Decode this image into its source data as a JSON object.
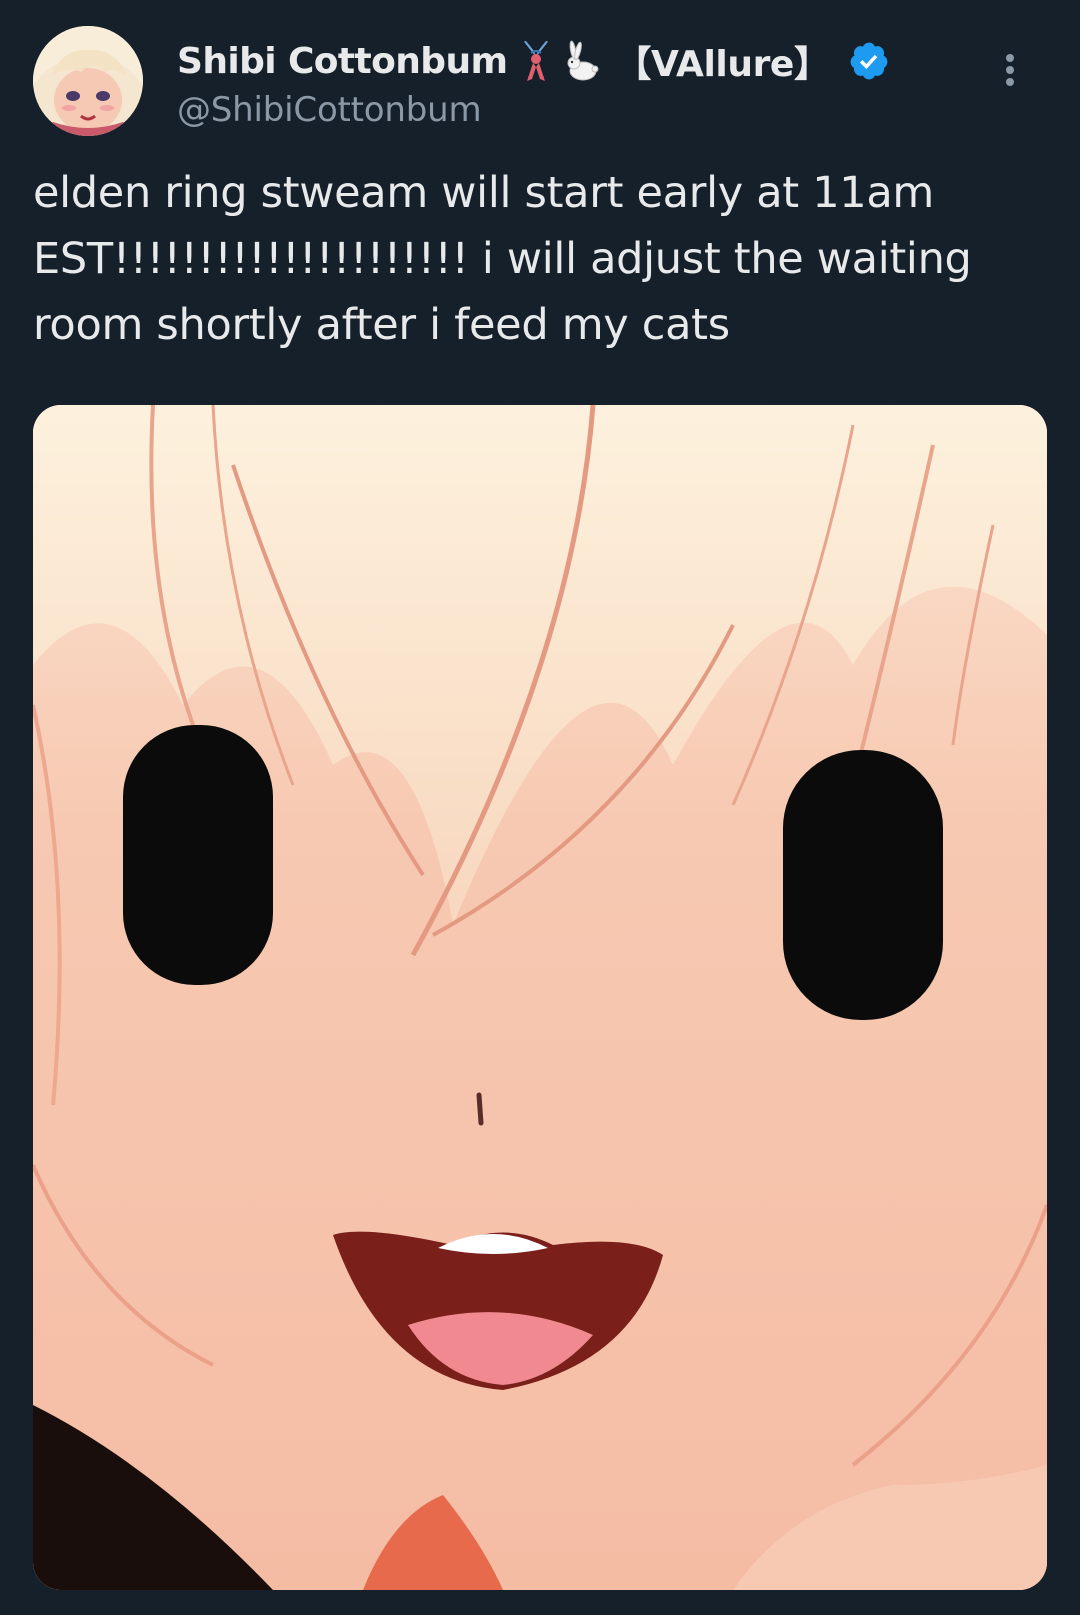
{
  "tweet": {
    "author": {
      "display_name": "Shibi Cottonbum",
      "tag": "【VAllure】",
      "handle": "@ShibiCottonbum",
      "verified": true,
      "name_emojis": [
        "ribbon-emoji",
        "rabbit-emoji"
      ],
      "avatar_icon": "anime-avatar-icon"
    },
    "text": "elden ring stweam will start early at 11am\nEST!!!!!!!!!!!!!!!!!!!!! i will adjust the waiting\nroom shortly after i feed my cats",
    "media": {
      "kind": "image",
      "subject": "anime-face-closeup"
    },
    "more_icon": "more-vertical-icon"
  },
  "colors": {
    "background": "#15202b",
    "text_primary": "#e7e9ea",
    "text_secondary": "#8b98a5",
    "verified_blue": "#1d9bf0"
  }
}
